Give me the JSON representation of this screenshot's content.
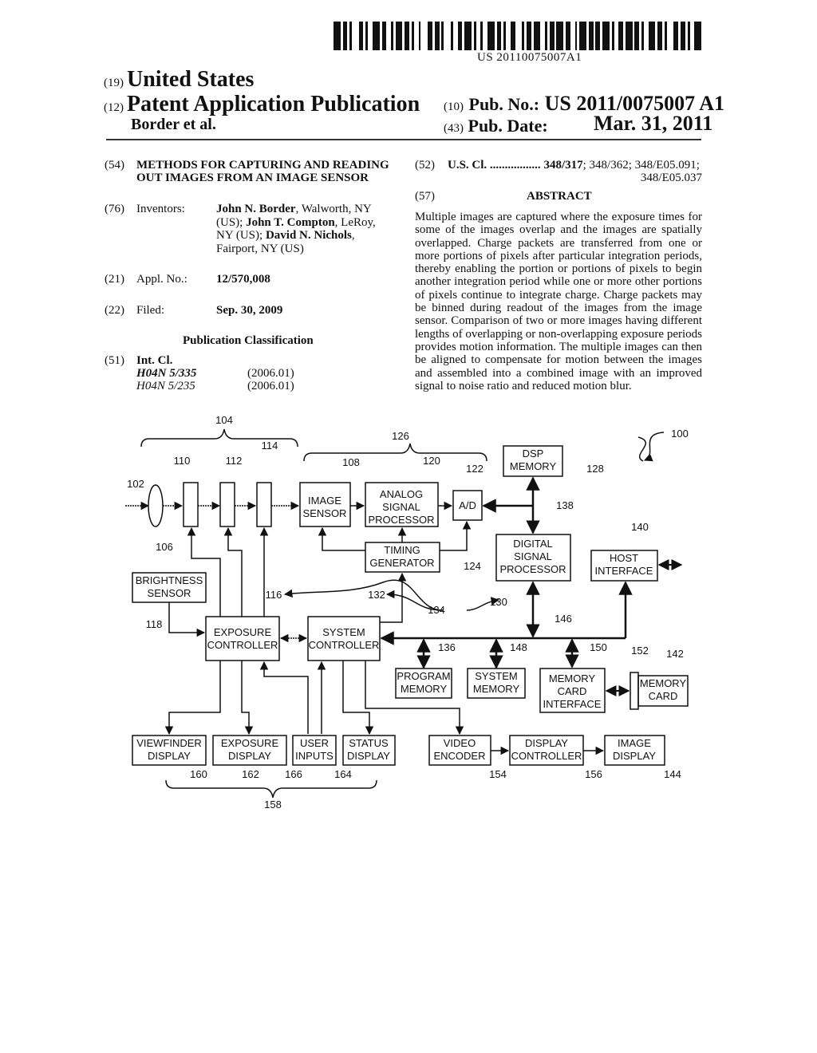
{
  "header": {
    "barcode_number": "US 20110075007A1",
    "country_code": "(19)",
    "country": "United States",
    "type_code": "(12)",
    "type": "Patent Application Publication",
    "authors": "Border et al.",
    "pub_no_code": "(10)",
    "pub_no_label": "Pub. No.:",
    "pub_no": "US 2011/0075007 A1",
    "pub_date_code": "(43)",
    "pub_date_label": "Pub. Date:",
    "pub_date": "Mar. 31, 2011"
  },
  "left_column": {
    "title_code": "(54)",
    "title_line1": "METHODS FOR CAPTURING AND READING",
    "title_line2": "OUT IMAGES FROM AN IMAGE SENSOR",
    "inventors_code": "(76)",
    "inventors_label": "Inventors:",
    "inventors": [
      {
        "name": "John N. Border",
        "location": ", Walworth, NY"
      },
      {
        "location": "(US); ",
        "name": "John T. Compton",
        "after": ", LeRoy,"
      },
      {
        "location": "NY (US); ",
        "name": "David N. Nichols",
        "after": ","
      },
      {
        "location": "Fairport, NY (US)"
      }
    ],
    "appl_code": "(21)",
    "appl_label": "Appl. No.:",
    "appl_no": "12/570,008",
    "filed_code": "(22)",
    "filed_label": "Filed:",
    "filed": "Sep. 30, 2009",
    "classification_heading": "Publication Classification",
    "int_cl_code": "(51)",
    "int_cl_label": "Int. Cl.",
    "int_cl": [
      {
        "code": "H04N 5/335",
        "version": "(2006.01)"
      },
      {
        "code": "H04N 5/235",
        "version": "(2006.01)"
      }
    ]
  },
  "right_column": {
    "us_cl_code": "(52)",
    "us_cl_label": "U.S. Cl. .................",
    "us_cl_primary": "348/317",
    "us_cl_rest": "; 348/362; 348/E05.091;",
    "us_cl_line2": "348/E05.037",
    "abstract_code": "(57)",
    "abstract_heading": "ABSTRACT",
    "abstract": "Multiple images are captured where the exposure times for some of the images overlap and the images are spatially overlapped. Charge packets are transferred from one or more portions of pixels after particular integration periods, thereby enabling the portion or portions of pixels to begin another integration period while one or more other portions of pixels continue to integrate charge. Charge packets may be binned during readout of the images from the image sensor. Comparison of two or more images having different lengths of overlapping or non-overlapping exposure periods provides motion information. The multiple images can then be aligned to compensate for motion between the images and assembled into a combined image with an improved signal to noise ratio and reduced motion blur."
  },
  "diagram": {
    "figure_ref": "100",
    "blocks": {
      "image_sensor": [
        "IMAGE",
        "SENSOR"
      ],
      "asp": [
        "ANALOG",
        "SIGNAL",
        "PROCESSOR"
      ],
      "ad": [
        "A/D"
      ],
      "dsp_memory": [
        "DSP",
        "MEMORY"
      ],
      "timing": [
        "TIMING",
        "GENERATOR"
      ],
      "dsp": [
        "DIGITAL",
        "SIGNAL",
        "PROCESSOR"
      ],
      "host": [
        "HOST",
        "INTERFACE"
      ],
      "brightness": [
        "BRIGHTNESS",
        "SENSOR"
      ],
      "exposure_ctrl": [
        "EXPOSURE",
        "CONTROLLER"
      ],
      "system_ctrl": [
        "SYSTEM",
        "CONTROLLER"
      ],
      "program_mem": [
        "PROGRAM",
        "MEMORY"
      ],
      "system_mem": [
        "SYSTEM",
        "MEMORY"
      ],
      "mem_card_if": [
        "MEMORY",
        "CARD",
        "INTERFACE"
      ],
      "mem_card": [
        "MEMORY",
        "CARD"
      ],
      "viewfinder": [
        "VIEWFINDER",
        "DISPLAY"
      ],
      "exposure_disp": [
        "EXPOSURE",
        "DISPLAY"
      ],
      "user_inputs": [
        "USER",
        "INPUTS"
      ],
      "status_disp": [
        "STATUS",
        "DISPLAY"
      ],
      "video_enc": [
        "VIDEO",
        "ENCODER"
      ],
      "display_ctrl": [
        "DISPLAY",
        "CONTROLLER"
      ],
      "image_disp": [
        "IMAGE",
        "DISPLAY"
      ]
    },
    "refs": {
      "r102": "102",
      "r104": "104",
      "r106": "106",
      "r108": "108",
      "r110": "110",
      "r112": "112",
      "r114": "114",
      "r116": "116",
      "r118": "118",
      "r120": "120",
      "r122": "122",
      "r124": "124",
      "r126": "126",
      "r128": "128",
      "r130": "130",
      "r132": "132",
      "r134": "134",
      "r136": "136",
      "r138": "138",
      "r140": "140",
      "r142": "142",
      "r144": "144",
      "r146": "146",
      "r148": "148",
      "r150": "150",
      "r152": "152",
      "r154": "154",
      "r156": "156",
      "r158": "158",
      "r160": "160",
      "r162": "162",
      "r164": "164",
      "r166": "166"
    }
  }
}
